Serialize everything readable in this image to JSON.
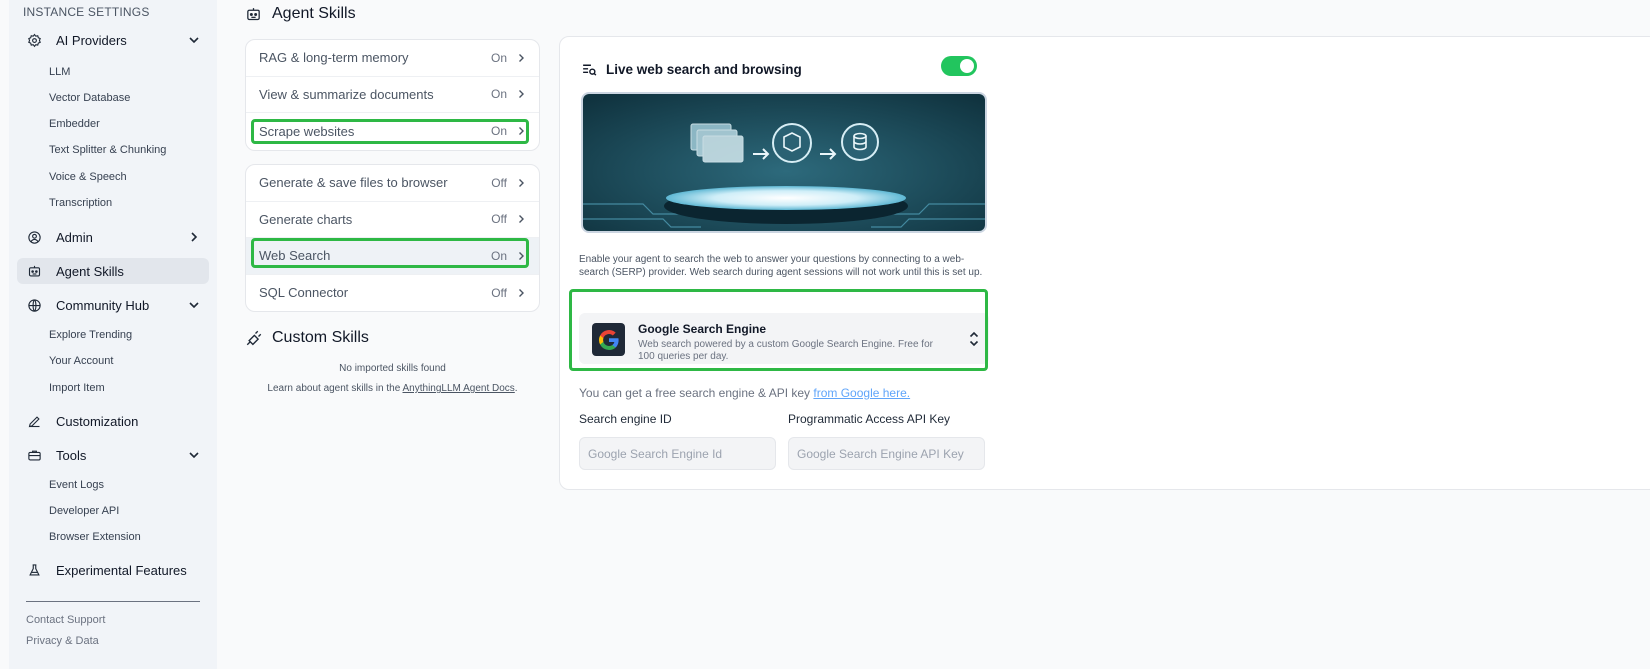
{
  "sidebar": {
    "heading": "INSTANCE SETTINGS",
    "ai_providers": {
      "label": "AI Providers",
      "items": [
        "LLM",
        "Vector Database",
        "Embedder",
        "Text Splitter & Chunking",
        "Voice & Speech",
        "Transcription"
      ]
    },
    "admin": {
      "label": "Admin"
    },
    "agent_skills": {
      "label": "Agent Skills"
    },
    "community_hub": {
      "label": "Community Hub",
      "items": [
        "Explore Trending",
        "Your Account",
        "Import Item"
      ]
    },
    "customization": {
      "label": "Customization"
    },
    "tools": {
      "label": "Tools",
      "items": [
        "Event Logs",
        "Developer API",
        "Browser Extension"
      ]
    },
    "experimental": {
      "label": "Experimental Features"
    },
    "footer": {
      "contact": "Contact Support",
      "privacy": "Privacy & Data"
    }
  },
  "page": {
    "title": "Agent Skills"
  },
  "skills": {
    "group1": [
      {
        "name": "RAG & long-term memory",
        "state": "On"
      },
      {
        "name": "View & summarize documents",
        "state": "On"
      },
      {
        "name": "Scrape websites",
        "state": "On"
      }
    ],
    "group2": [
      {
        "name": "Generate & save files to browser",
        "state": "Off"
      },
      {
        "name": "Generate charts",
        "state": "Off"
      },
      {
        "name": "Web Search",
        "state": "On"
      },
      {
        "name": "SQL Connector",
        "state": "Off"
      }
    ]
  },
  "custom_skills": {
    "title": "Custom Skills",
    "empty": "No imported skills found",
    "learn_prefix": "Learn about agent skills in the ",
    "learn_link": "AnythingLLM Agent Docs",
    "learn_suffix": "."
  },
  "detail": {
    "title": "Live web search and browsing",
    "enabled": true,
    "description": "Enable your agent to search the web to answer your questions by connecting to a web-search (SERP) provider. Web search during agent sessions will not work until this is set up.",
    "engine": {
      "name": "Google Search Engine",
      "description": "Web search powered by a custom Google Search Engine. Free for 100 queries per day."
    },
    "api_hint_prefix": "You can get a free search engine & API key ",
    "api_hint_link": "from Google here.",
    "field1": {
      "label": "Search engine ID",
      "placeholder": "Google Search Engine Id"
    },
    "field2": {
      "label": "Programmatic Access API Key",
      "placeholder": "Google Search Engine API Key"
    }
  },
  "colors": {
    "accent_green": "#22c55e",
    "highlight_green": "#2eb845",
    "link_blue": "#60a5fa"
  },
  "icons": {
    "ai_providers": "gear-icon",
    "admin": "user-gear-icon",
    "agent_skills": "robot-icon",
    "community_hub": "globe-icon",
    "customization": "pencil-icon",
    "tools": "toolbox-icon",
    "experimental": "flask-icon",
    "custom_skills": "plug-icon",
    "detail": "list-search-icon"
  }
}
